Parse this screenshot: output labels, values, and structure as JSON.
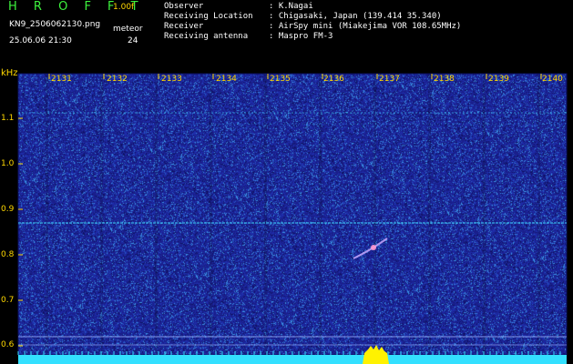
{
  "header": {
    "app_name": "H R O F F T",
    "version": "1.00f",
    "filename": "KN9_2506062130.png",
    "mode": "meteor",
    "datetime": "25.06.06 21:30",
    "count": "24"
  },
  "info": [
    {
      "label": "Observer",
      "sep": ":",
      "value": "K.Nagai"
    },
    {
      "label": "Receiving Location",
      "sep": ":",
      "value": "Chigasaki, Japan (139.414 35.340)"
    },
    {
      "label": "Receiver",
      "sep": ":",
      "value": "AirSpy mini (Miakejima VOR 108.65MHz)"
    },
    {
      "label": "Receiving antenna",
      "sep": ":",
      "value": "Maspro FM-3"
    }
  ],
  "axes": {
    "y_unit": "kHz",
    "x_ticks": [
      "2131",
      "2132",
      "2133",
      "2134",
      "2135",
      "2136",
      "2137",
      "2138",
      "2139",
      "2140"
    ],
    "y_ticks": [
      "1.1",
      "1.0",
      "0.9",
      "0.8",
      "0.7",
      "0.6"
    ]
  },
  "colors": {
    "background": "#000000",
    "plot_bg": "#1a1f8c",
    "title": "#3df23d",
    "tick": "#ffd800",
    "signal": "#40d8ff",
    "baseline": "#33e0ff",
    "burst": "#fff200"
  }
}
